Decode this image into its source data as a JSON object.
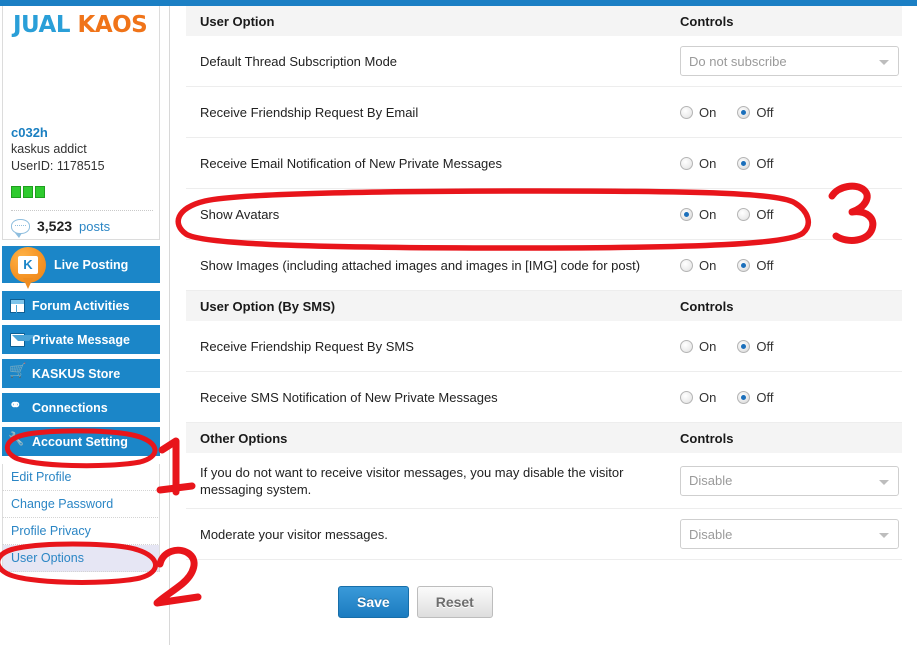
{
  "brand": {
    "part1": "JUAL",
    "part2": "KAOS"
  },
  "profile": {
    "username": "c032h",
    "rank": "kaskus addict",
    "userid": "UserID: 1178515",
    "badge_count": 3,
    "posts_count": "3,523",
    "posts_label": "posts"
  },
  "sidebar": {
    "nav": [
      {
        "label": "Live Posting",
        "icon": "kaskus-pin-icon",
        "highlight": true
      },
      {
        "label": "Forum Activities",
        "icon": "forum-window-icon"
      },
      {
        "label": "Private Message",
        "icon": "envelope-icon"
      },
      {
        "label": "KASKUS Store",
        "icon": "shopping-cart-icon"
      },
      {
        "label": "Connections",
        "icon": "connections-icon"
      },
      {
        "label": "Account Setting",
        "icon": "wrench-icon"
      }
    ],
    "subnav": [
      {
        "label": "Edit Profile",
        "active": false
      },
      {
        "label": "Change Password",
        "active": false
      },
      {
        "label": "Profile Privacy",
        "active": false
      },
      {
        "label": "User Options",
        "active": true
      }
    ]
  },
  "main": {
    "sections": [
      {
        "title": "User Option",
        "controls_header": "Controls",
        "rows": [
          {
            "label": "Default Thread Subscription Mode",
            "control": "select",
            "value": "Do not subscribe"
          },
          {
            "label": "Receive Friendship Request By Email",
            "control": "radio",
            "on_label": "On",
            "off_label": "Off",
            "selected": "Off"
          },
          {
            "label": "Receive Email Notification of New Private Messages",
            "control": "radio",
            "on_label": "On",
            "off_label": "Off",
            "selected": "Off"
          },
          {
            "label": "Show Avatars",
            "control": "radio",
            "on_label": "On",
            "off_label": "Off",
            "selected": "On"
          },
          {
            "label": "Show Images (including attached images and images in [IMG] code for post)",
            "control": "radio",
            "on_label": "On",
            "off_label": "Off",
            "selected": "Off"
          }
        ]
      },
      {
        "title": "User Option (By SMS)",
        "controls_header": "Controls",
        "rows": [
          {
            "label": "Receive Friendship Request By SMS",
            "control": "radio",
            "on_label": "On",
            "off_label": "Off",
            "selected": "Off"
          },
          {
            "label": "Receive SMS Notification of New Private Messages",
            "control": "radio",
            "on_label": "On",
            "off_label": "Off",
            "selected": "Off"
          }
        ]
      },
      {
        "title": "Other Options",
        "controls_header": "Controls",
        "rows": [
          {
            "label": "If you do not want to receive visitor messages, you may disable the visitor messaging system.",
            "control": "select",
            "value": "Disable"
          },
          {
            "label": "Moderate your visitor messages.",
            "control": "select",
            "value": "Disable"
          }
        ]
      }
    ],
    "buttons": {
      "save": "Save",
      "reset": "Reset"
    }
  },
  "annotations": {
    "color": "#e8151b",
    "marks": [
      {
        "name": "annotation-number-1",
        "text": "1"
      },
      {
        "name": "annotation-number-2",
        "text": "2"
      },
      {
        "name": "annotation-number-3",
        "text": "3"
      }
    ]
  }
}
